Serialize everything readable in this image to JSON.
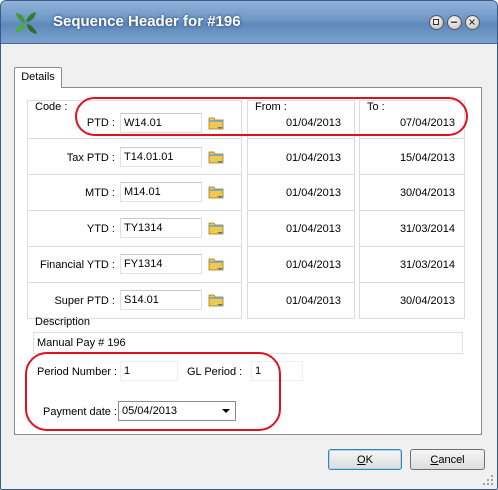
{
  "window": {
    "title": "Sequence Header for #196"
  },
  "tabs": [
    {
      "label": "Details",
      "active": true
    }
  ],
  "header": {
    "code_label": "Code :",
    "from_label": "From :",
    "to_label": "To :"
  },
  "rows": [
    {
      "label": "PTD :",
      "code": "W14.01",
      "from": "01/04/2013",
      "to": "07/04/2013"
    },
    {
      "label": "Tax PTD :",
      "code": "T14.01.01",
      "from": "01/04/2013",
      "to": "15/04/2013"
    },
    {
      "label": "MTD :",
      "code": "M14.01",
      "from": "01/04/2013",
      "to": "30/04/2013"
    },
    {
      "label": "YTD :",
      "code": "TY1314",
      "from": "01/04/2013",
      "to": "31/03/2014"
    },
    {
      "label": "Financial YTD :",
      "code": "FY1314",
      "from": "01/04/2013",
      "to": "31/03/2014"
    },
    {
      "label": "Super PTD :",
      "code": "S14.01",
      "from": "01/04/2013",
      "to": "30/04/2013"
    }
  ],
  "description": {
    "label": "Description",
    "value": "Manual Pay # 196"
  },
  "period": {
    "period_label": "Period Number :",
    "period_value": "1",
    "gl_label": "GL Period :",
    "gl_value": "1"
  },
  "payment": {
    "label": "Payment date :",
    "value": "05/04/2013"
  },
  "buttons": {
    "ok_underline": "O",
    "ok_rest": "K",
    "cancel_underline": "C",
    "cancel_rest": "ancel"
  },
  "colors": {
    "title_bar": "#6f97c6",
    "highlight_oval": "#e0111e"
  },
  "icons": [
    "app-leaf-icon",
    "restore-icon",
    "minimize-icon",
    "close-icon",
    "folder-browse-icon",
    "dropdown-arrow-icon",
    "resize-grip-icon"
  ]
}
